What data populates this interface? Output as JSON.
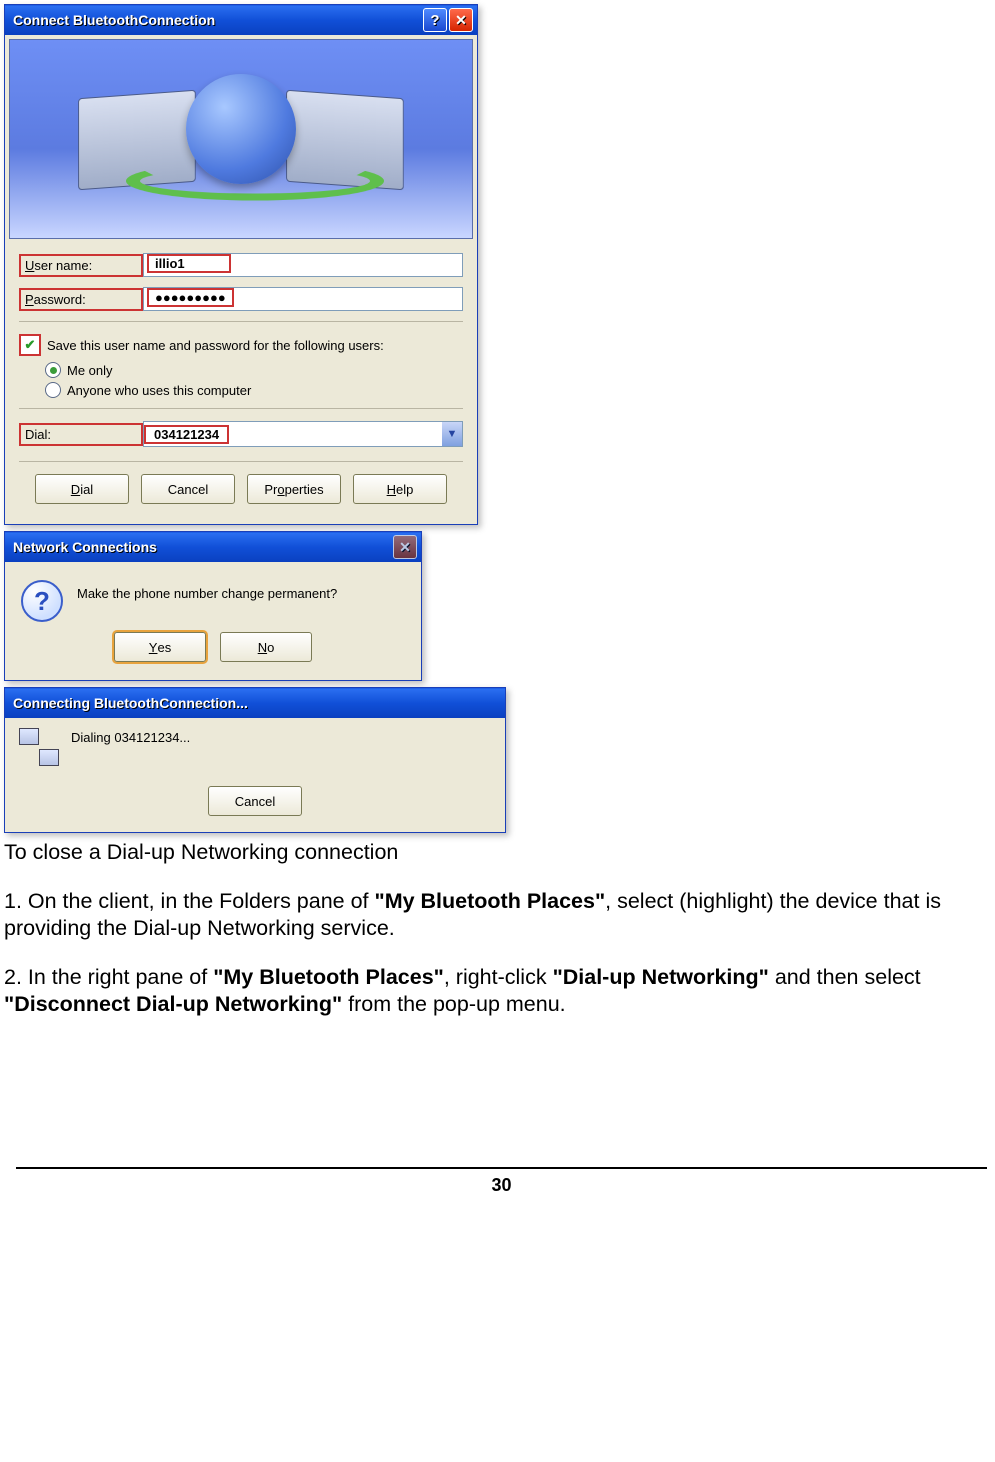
{
  "connect_dialog": {
    "title": "Connect BluetoothConnection",
    "username_label_html": "User name:",
    "username_value": "illio1",
    "password_label_html": "Password:",
    "password_mask": "●●●●●●●●●",
    "save_label_html": "Save this user name and password for the following users:",
    "radio_me": "Me only",
    "radio_anyone": "Anyone who uses this computer",
    "dial_label": "Dial:",
    "dial_value": "034121234",
    "btn_dial": "Dial",
    "btn_cancel": "Cancel",
    "btn_properties": "Properties",
    "btn_help": "Help"
  },
  "confirm_dialog": {
    "title": "Network Connections",
    "message": "Make the phone number change permanent?",
    "yes": "Yes",
    "no": "No"
  },
  "progress_dialog": {
    "title": "Connecting BluetoothConnection...",
    "message": "Dialing 034121234...",
    "cancel": "Cancel"
  },
  "instructions": {
    "heading": "To close a Dial-up Networking connection",
    "step1_a": "1. On the client, in the Folders pane of ",
    "step1_b": "\"My Bluetooth Places\"",
    "step1_c": ", select (highlight) the device that is providing the Dial-up Networking service.",
    "step2_a": "2. In the right pane of ",
    "step2_b": "\"My Bluetooth Places\"",
    "step2_c": ", right-click ",
    "step2_d": "\"Dial-up Networking\"",
    "step2_e": " and then select ",
    "step2_f": "\"Disconnect Dial-up Networking\"",
    "step2_g": " from the pop-up menu."
  },
  "page_number": "30"
}
